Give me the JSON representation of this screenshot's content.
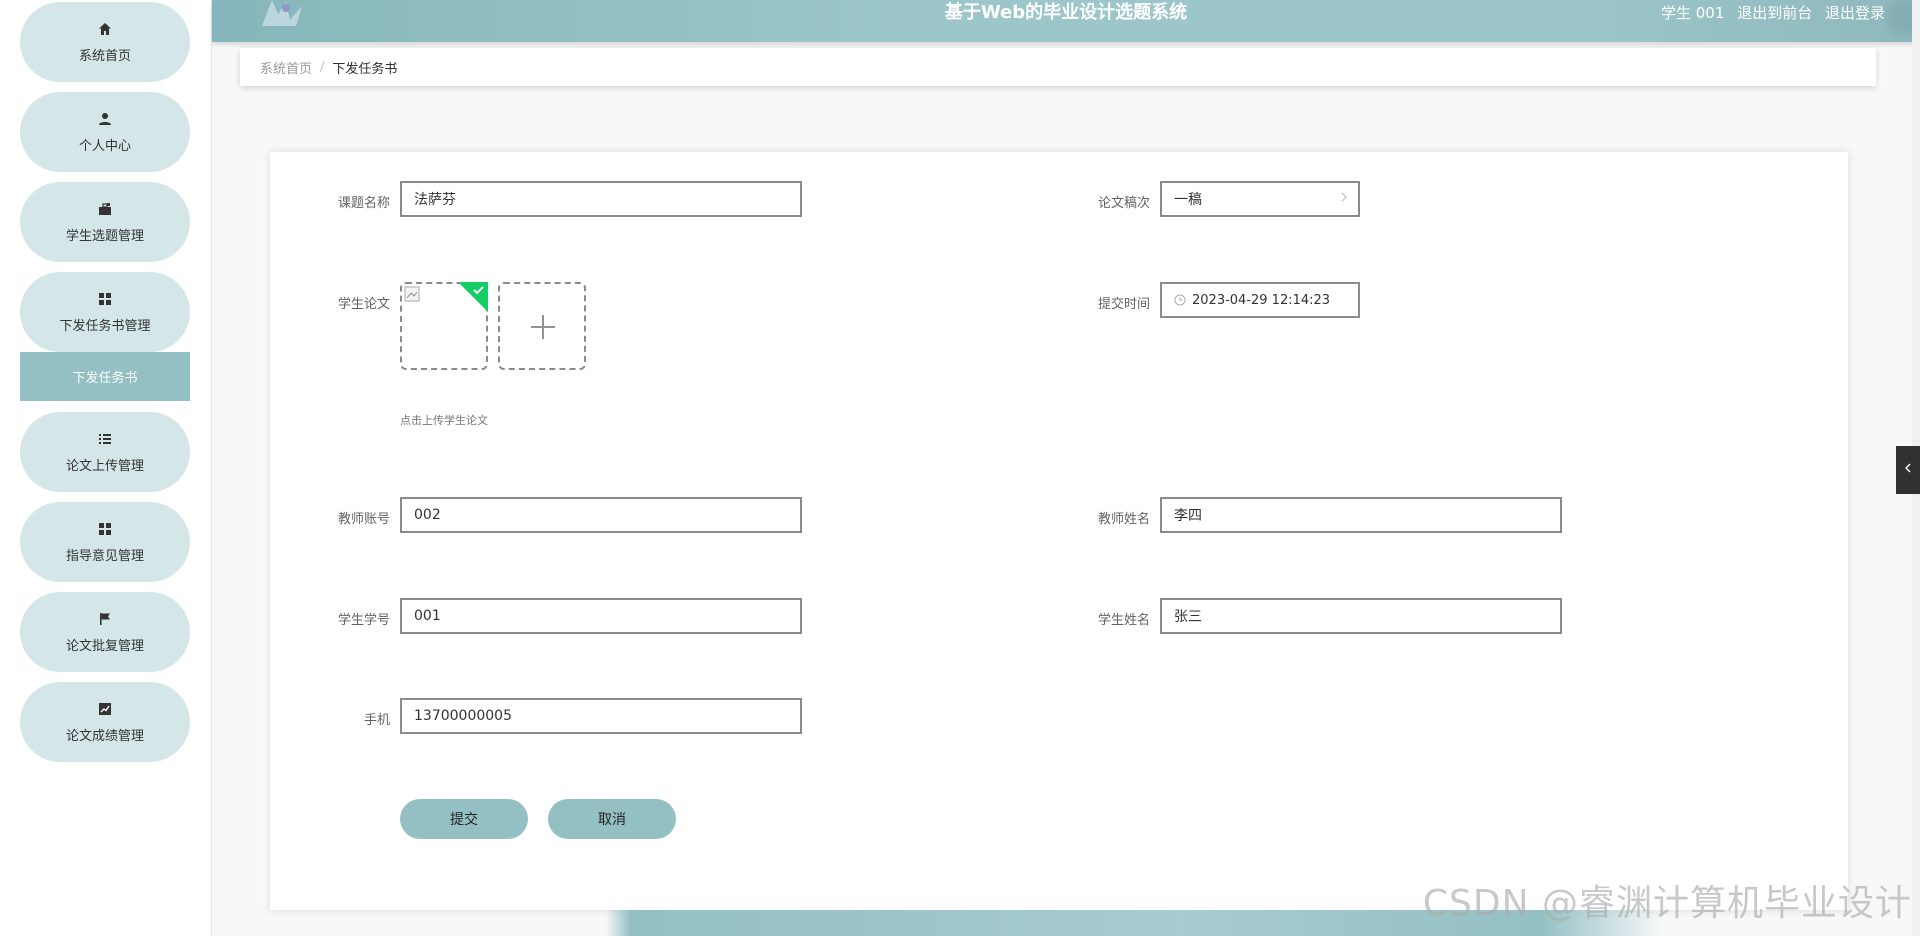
{
  "sidebar": {
    "items": [
      {
        "label": "系统首页",
        "icon": "home-icon"
      },
      {
        "label": "个人中心",
        "icon": "user-icon"
      },
      {
        "label": "学生选题管理",
        "icon": "briefcase-icon"
      },
      {
        "label": "下发任务书管理",
        "icon": "grid-icon"
      },
      {
        "label": "论文上传管理",
        "icon": "list-icon"
      },
      {
        "label": "指导意见管理",
        "icon": "grid-icon"
      },
      {
        "label": "论文批复管理",
        "icon": "flag-icon"
      },
      {
        "label": "论文成绩管理",
        "icon": "chart-icon"
      }
    ],
    "active_sub": "下发任务书"
  },
  "header": {
    "title": "基于Web的毕业设计选题系统",
    "user": "学生 001",
    "to_front": "退出到前台",
    "logout": "退出登录"
  },
  "breadcrumb": {
    "home": "系统首页",
    "separator": "/",
    "current": "下发任务书"
  },
  "form": {
    "topic_label": "课题名称",
    "topic_value": "法萨芬",
    "draft_label": "论文稿次",
    "draft_value": "一稿",
    "paper_label": "学生论文",
    "upload_tip": "点击上传学生论文",
    "submit_time_label": "提交时间",
    "submit_time_value": "2023-04-29 12:14:23",
    "teacher_account_label": "教师账号",
    "teacher_account_value": "002",
    "teacher_name_label": "教师姓名",
    "teacher_name_value": "李四",
    "student_no_label": "学生学号",
    "student_no_value": "001",
    "student_name_label": "学生姓名",
    "student_name_value": "张三",
    "phone_label": "手机",
    "phone_value": "13700000005",
    "submit_button": "提交",
    "cancel_button": "取消"
  },
  "watermark": "CSDN @睿渊计算机毕业设计",
  "colors": {
    "accent": "#94c0c4",
    "nav_bg": "#d4e6e8",
    "header": "#9cc6ca"
  }
}
